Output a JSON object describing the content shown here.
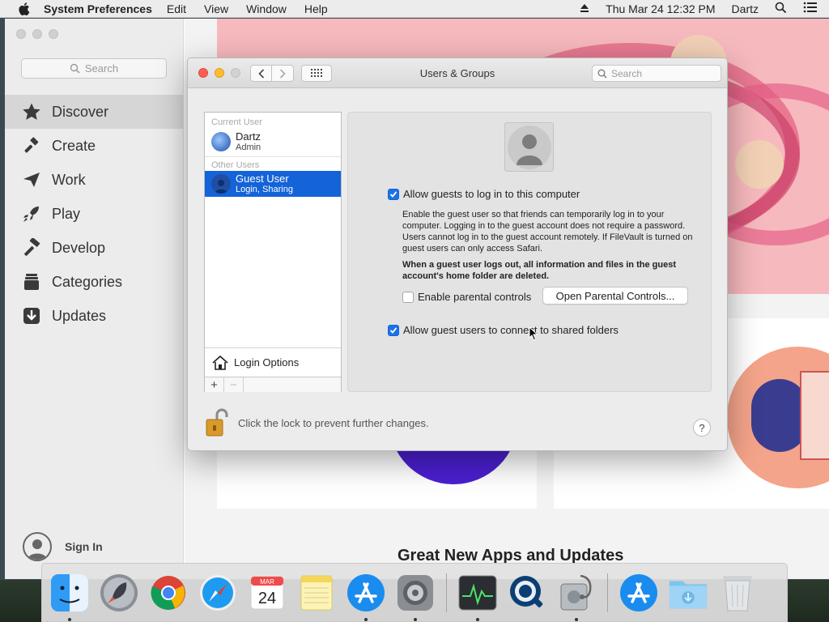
{
  "menubar": {
    "app_name": "System Preferences",
    "menus": [
      "Edit",
      "View",
      "Window",
      "Help"
    ],
    "datetime": "Thu Mar 24  12:32 PM",
    "user": "Dartz"
  },
  "appstore": {
    "search_placeholder": "Search",
    "nav": [
      {
        "label": "Discover",
        "icon": "star-icon",
        "active": true
      },
      {
        "label": "Create",
        "icon": "hammer-brush-icon"
      },
      {
        "label": "Work",
        "icon": "paper-plane-icon"
      },
      {
        "label": "Play",
        "icon": "rocket-icon"
      },
      {
        "label": "Develop",
        "icon": "hammer-icon"
      },
      {
        "label": "Categories",
        "icon": "stack-icon"
      },
      {
        "label": "Updates",
        "icon": "download-icon"
      }
    ],
    "sign_in": "Sign In",
    "section_title": "Great New Apps and Updates"
  },
  "users_groups": {
    "title": "Users & Groups",
    "search_placeholder": "Search",
    "current_user_header": "Current User",
    "current_user": {
      "name": "Dartz",
      "role": "Admin"
    },
    "other_users_header": "Other Users",
    "guest_user": {
      "name": "Guest User",
      "detail": "Login, Sharing"
    },
    "login_options": "Login Options",
    "add_symbol": "+",
    "remove_symbol": "−",
    "allow_guests_label": "Allow guests to log in to this computer",
    "allow_guests_checked": true,
    "description": "Enable the guest user so that friends can temporarily log in to your computer. Logging in to the guest account does not require a password. Users cannot log in to the guest account remotely. If FileVault is turned on guest users can only access Safari.",
    "warning": "When a guest user logs out, all information and files in the guest account's home folder are deleted.",
    "parental_label": "Enable parental controls",
    "parental_checked": false,
    "parental_button": "Open Parental Controls...",
    "shared_folders_label": "Allow guest users to connect to shared folders",
    "shared_folders_checked": true,
    "lock_text": "Click the lock to prevent further changes.",
    "help_symbol": "?"
  },
  "calendar": {
    "month": "MAR",
    "day": "24"
  },
  "dock": [
    "Finder",
    "Launchpad",
    "Google Chrome",
    "Safari",
    "Calendar",
    "Notes",
    "App Store",
    "System Preferences",
    "Activity Monitor",
    "QuickTime Player",
    "Disk Utility",
    "App Store",
    "Downloads",
    "Trash"
  ],
  "colors": {
    "selection": "#1463d8",
    "checkbox": "#1a73e8",
    "close": "#fc5f57",
    "minimize": "#fdbc2e"
  }
}
